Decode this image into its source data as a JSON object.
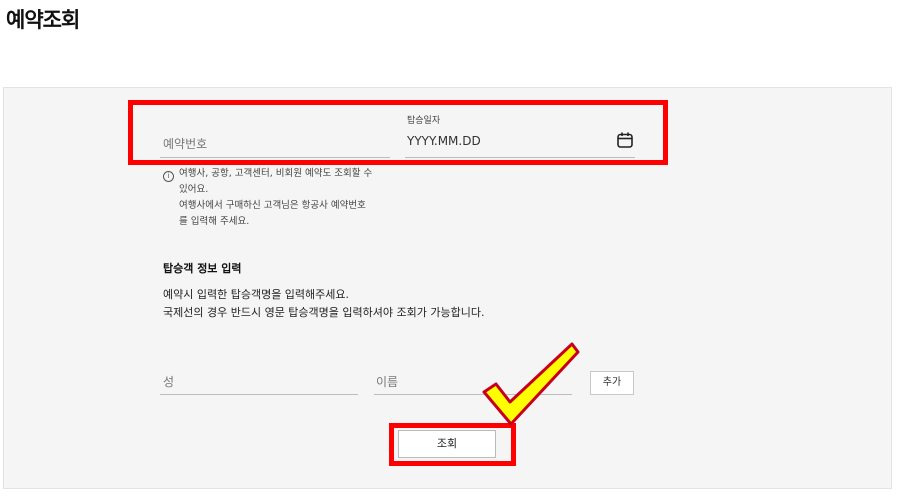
{
  "header": {
    "title": "예약조회"
  },
  "reservation": {
    "number_placeholder": "예약번호",
    "date_label": "탑승일자",
    "date_placeholder": "YYYY.MM.DD",
    "calendar_icon": "calendar-icon"
  },
  "notice": {
    "info_icon": "info-icon",
    "line1": "여행사, 공항, 고객센터, 비회원 예약도 조회할 수",
    "line2": "있어요.",
    "line3": "여행사에서 구매하신 고객님은 항공사 예약번호",
    "line4": "를 입력해 주세요."
  },
  "passenger": {
    "section_title": "탑승객 정보 입력",
    "desc1": "예약시 입력한 탑승객명을 입력해주세요.",
    "desc2": "국제선의 경우 반드시 영문 탑승객명을 입력하셔야 조회가 가능합니다.",
    "last_name_placeholder": "성",
    "first_name_placeholder": "이름",
    "add_label": "추가"
  },
  "actions": {
    "search_label": "조회"
  },
  "annotations": {
    "highlight_color": "#ff0000",
    "checkmark_color": "#ffff00"
  }
}
